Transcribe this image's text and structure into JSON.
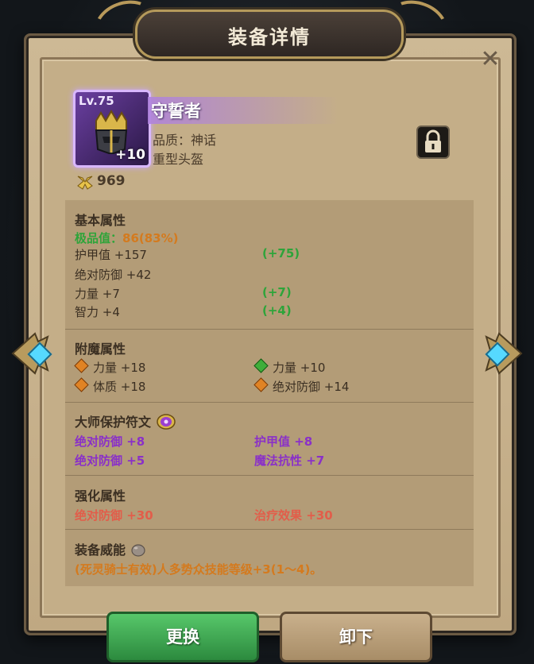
{
  "window": {
    "title": "装备详情"
  },
  "item": {
    "level": "Lv.75",
    "enhance": "+10",
    "name": "守誓者",
    "quality": "品质：神话",
    "type": "重型头盔",
    "power": "969"
  },
  "basic": {
    "title": "基本属性",
    "rating_label": "极品值：",
    "rating_value": "86(83%)",
    "rows": [
      {
        "label": "护甲值 +157",
        "bonus": "(+75)"
      },
      {
        "label": "绝对防御 +42",
        "bonus": ""
      },
      {
        "label": "力量 +7",
        "bonus": "(+7)"
      },
      {
        "label": "智力 +4",
        "bonus": "(+4)"
      }
    ]
  },
  "enchant": {
    "title": "附魔属性",
    "left": [
      "力量 +18",
      "体质 +18"
    ],
    "right": [
      "力量 +10",
      "绝对防御 +14"
    ]
  },
  "rune": {
    "title": "大师保护符文",
    "left": [
      "绝对防御 +8",
      "绝对防御 +5"
    ],
    "right": [
      "护甲值 +8",
      "魔法抗性 +7"
    ]
  },
  "strengthen": {
    "title": "强化属性",
    "left": "绝对防御 +30",
    "right": "治疗效果 +30"
  },
  "power_skill": {
    "title": "装备威能",
    "text": "(死灵骑士有效)人多势众技能等级+3(1～4)。"
  },
  "buttons": {
    "replace": "更换",
    "unequip": "卸下"
  },
  "colors": {
    "accent_green": "#2ea43a",
    "accent_orange": "#d47a1e",
    "accent_purple": "#8a30c8",
    "accent_red": "#e25d4a",
    "button_green": "#3fa84f",
    "parchment": "#c7b18c"
  },
  "icons": {
    "close": "close-icon",
    "lock": "lock-icon",
    "power": "power-icon",
    "rune": "rune-icon",
    "power_skill": "stone-icon"
  }
}
